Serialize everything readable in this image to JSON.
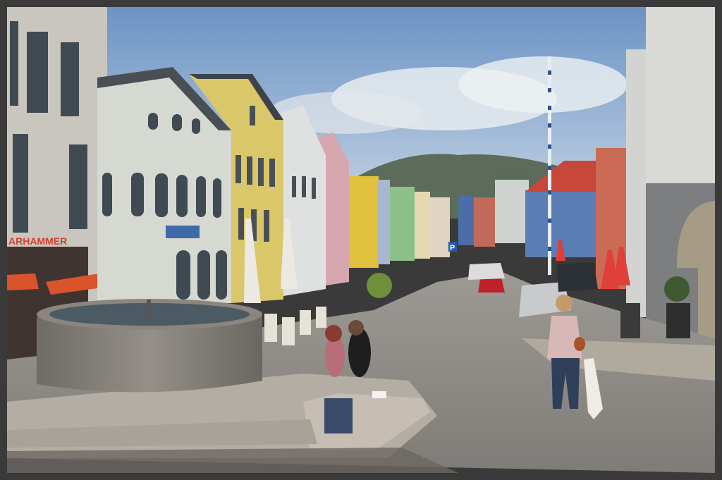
{
  "scene": {
    "shop_sign": "ARHAMMER",
    "parking_sign": "P",
    "colors": {
      "sky_top": "#6f97c9",
      "sky_bottom": "#b9cde0",
      "pavement": "#8f8c88",
      "awning": "#d9542b",
      "umbrella": "#e0403a",
      "car_red": "#c0202a",
      "car_silver": "#c8cacc"
    }
  }
}
